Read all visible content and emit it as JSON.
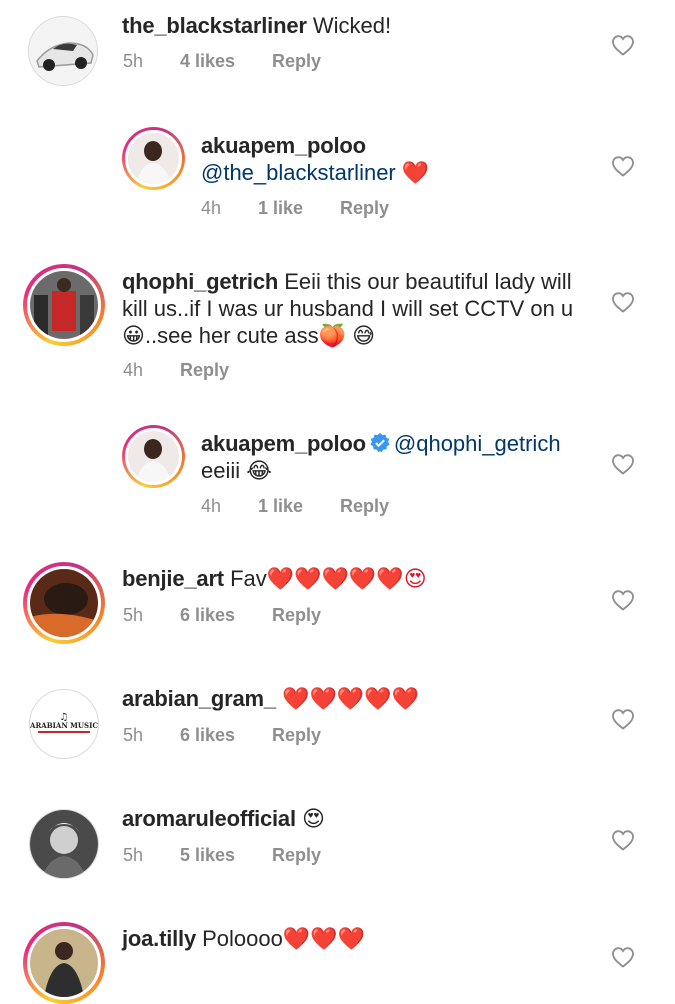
{
  "comments": [
    {
      "username": "the_blackstarliner",
      "text": "Wicked!",
      "time": "5h",
      "likes": "4 likes",
      "reply": "Reply"
    },
    {
      "username": "akuapem_poloo",
      "mention": "@the_blackstarliner",
      "emoji": "❤️",
      "time": "4h",
      "likes": "1 like",
      "reply": "Reply"
    },
    {
      "username": "qhophi_getrich",
      "line1": "Eeii this our beautiful lady will",
      "line2": "kill us..if I was ur husband I will set CCTV on u",
      "line3_emoji_a": "😀",
      "line3_text": "..see her cute ass",
      "line3_emoji_b": "🍑",
      "line3_emoji_c": "😅",
      "time": "4h",
      "reply": "Reply"
    },
    {
      "username": "akuapem_poloo",
      "mention": "@qhophi_getrich",
      "text": "eeiii",
      "emoji": "😂",
      "time": "4h",
      "likes": "1 like",
      "reply": "Reply"
    },
    {
      "username": "benjie_art",
      "text": "Fav",
      "emoji": "❤️❤️❤️❤️❤️😍",
      "time": "5h",
      "likes": "6 likes",
      "reply": "Reply"
    },
    {
      "username": "arabian_gram_",
      "emoji": "❤️❤️❤️❤️❤️",
      "time": "5h",
      "likes": "6 likes",
      "reply": "Reply",
      "avatar_text": "ARABIAN MUSIC"
    },
    {
      "username": "aromaruleofficial",
      "emoji": "😍",
      "time": "5h",
      "likes": "5 likes",
      "reply": "Reply"
    },
    {
      "username": "joa.tilly",
      "text": "Poloooo",
      "emoji": "❤️❤️❤️"
    }
  ],
  "colors": {
    "username": "#262626",
    "meta": "#8e8e8e",
    "mention": "#00376b",
    "heart": "#e0162b",
    "verified": "#3897f0"
  }
}
